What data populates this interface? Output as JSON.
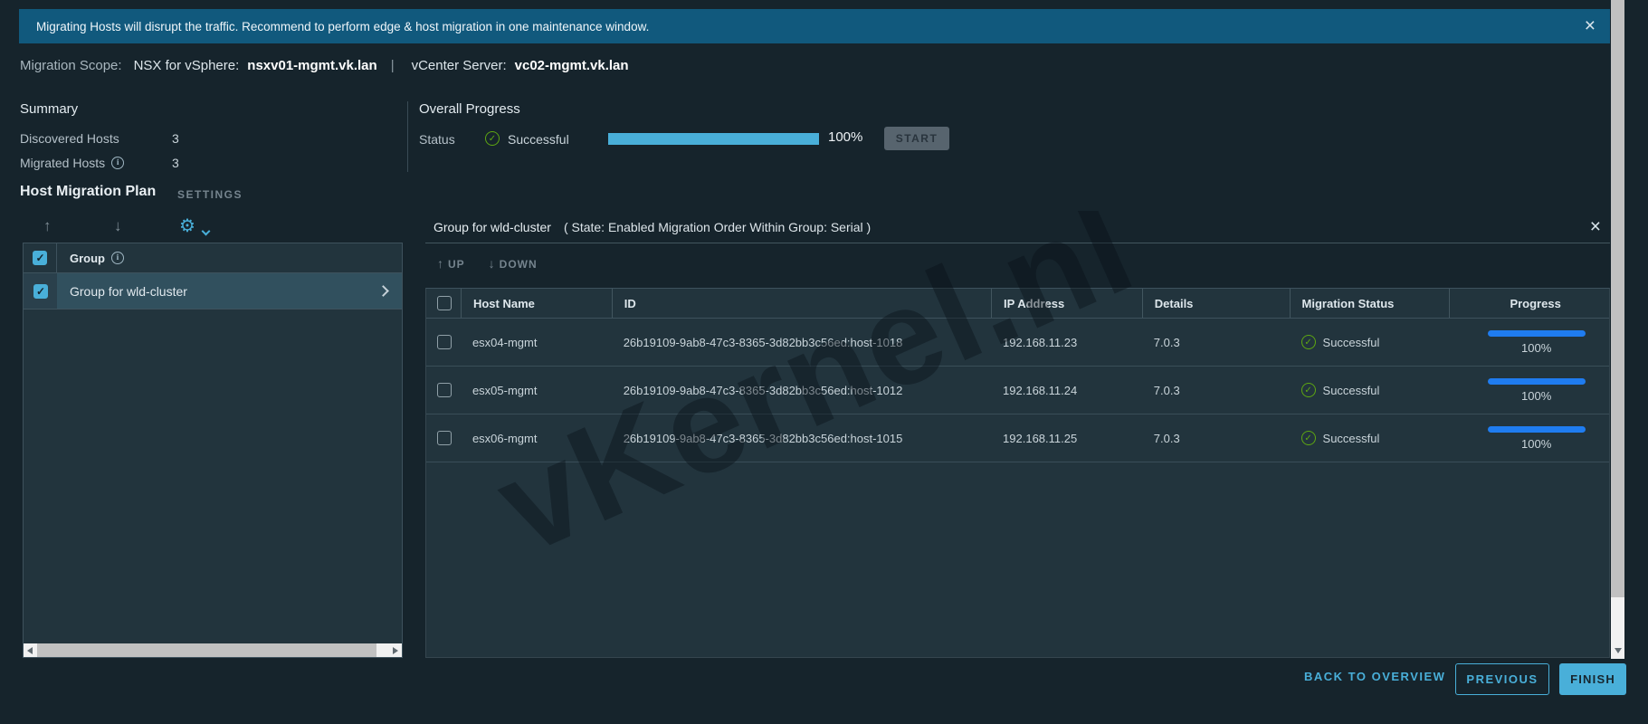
{
  "banner": {
    "text": "Migrating Hosts will disrupt the traffic. Recommend to perform edge & host migration in one maintenance window."
  },
  "scope": {
    "label": "Migration Scope:",
    "nsx_label": "NSX for vSphere:",
    "nsx_value": "nsxv01-mgmt.vk.lan",
    "separator": "|",
    "vc_label": "vCenter Server:",
    "vc_value": "vc02-mgmt.vk.lan"
  },
  "summary": {
    "title": "Summary",
    "rows": [
      {
        "label": "Discovered Hosts",
        "value": "3"
      },
      {
        "label": "Migrated Hosts",
        "value": "3"
      }
    ]
  },
  "overall_progress": {
    "title": "Overall Progress",
    "status_label": "Status",
    "status_value": "Successful",
    "percent": "100%",
    "progress_value": "100%",
    "start_label": "START"
  },
  "plan": {
    "title": "Host Migration Plan",
    "settings_label": "SETTINGS"
  },
  "left_panel": {
    "select_all_checked": true,
    "group_column": "Group",
    "groups": [
      {
        "name": "Group for wld-cluster",
        "checked": true,
        "selected": true
      }
    ]
  },
  "group_detail": {
    "title": "Group for wld-cluster",
    "info": "( State: Enabled    Migration Order Within Group: Serial )",
    "up_label": "UP",
    "down_label": "DOWN",
    "up_arrow": "↑",
    "down_arrow": "↓"
  },
  "hosts_table": {
    "columns": [
      "Host Name",
      "ID",
      "IP Address",
      "Details",
      "Migration Status",
      "Progress"
    ],
    "rows": [
      {
        "host_name": "esx04-mgmt",
        "id": "26b19109-9ab8-47c3-8365-3d82bb3c56ed:host-1018",
        "ip": "192.168.11.23",
        "details": "7.0.3",
        "status": "Successful",
        "progress": "100%"
      },
      {
        "host_name": "esx05-mgmt",
        "id": "26b19109-9ab8-47c3-8365-3d82bb3c56ed:host-1012",
        "ip": "192.168.11.24",
        "details": "7.0.3",
        "status": "Successful",
        "progress": "100%"
      },
      {
        "host_name": "esx06-mgmt",
        "id": "26b19109-9ab8-47c3-8365-3d82bb3c56ed:host-1015",
        "ip": "192.168.11.25",
        "details": "7.0.3",
        "status": "Successful",
        "progress": "100%"
      }
    ]
  },
  "footer": {
    "back_label": "BACK TO OVERVIEW",
    "previous_label": "PREVIOUS",
    "finish_label": "FINISH"
  },
  "watermark": "vKernel.nl",
  "icons": {
    "banner_close": "close-icon",
    "group_close": "close-icon",
    "settings_gear": "gear-icon",
    "success_check": "check-circle-icon",
    "info": "info-icon"
  },
  "colors": {
    "accent": "#49afd9",
    "banner_bg": "#11597d",
    "panel_bg": "#22343d",
    "page_bg": "#16242c",
    "success": "#5ea712",
    "progress_blue": "#1f7cf0"
  }
}
